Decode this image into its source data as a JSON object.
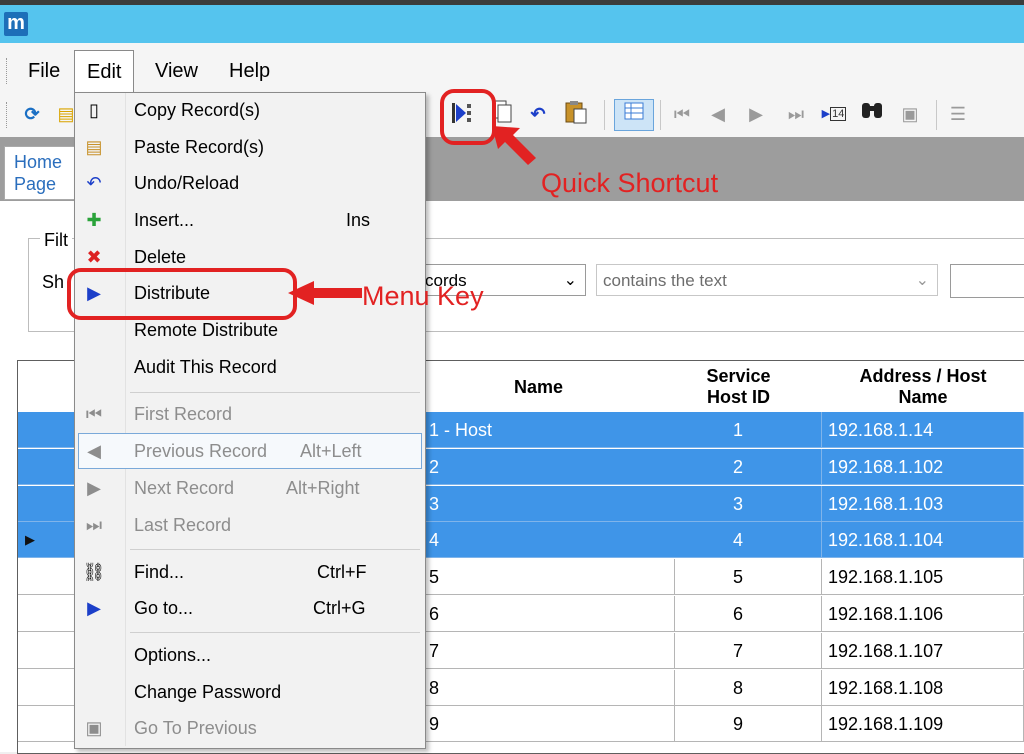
{
  "app": {
    "logo_letter": "m"
  },
  "menubar": {
    "items": [
      "File",
      "Edit",
      "View",
      "Help"
    ]
  },
  "toolbar": {
    "icons": [
      "refresh-icon",
      "folder-icon",
      "distribute-icon",
      "copy-icon",
      "undo-icon",
      "paste-icon",
      "grid-view-icon",
      "first-record-icon",
      "previous-record-icon",
      "next-record-icon",
      "last-record-icon",
      "go-to-icon",
      "find-icon",
      "go-to-previous-icon",
      "list-view-icon"
    ]
  },
  "tabs": {
    "home_line1": "Home",
    "home_line2": "Page"
  },
  "filter": {
    "legend": "Filt",
    "show_label": "Sh",
    "records_select": "cords",
    "match_select": "contains the text"
  },
  "grid": {
    "headers": {
      "name": "Name",
      "service_host_id_l1": "Service",
      "service_host_id_l2": "Host ID",
      "address_l1": "Address / Host",
      "address_l2": "Name"
    },
    "rows": [
      {
        "name": "1 - Host",
        "id": "1",
        "address": "192.168.1.14",
        "selected": true
      },
      {
        "name": "2",
        "id": "2",
        "address": "192.168.1.102",
        "selected": true
      },
      {
        "name": "3",
        "id": "3",
        "address": "192.168.1.103",
        "selected": true
      },
      {
        "name": "4",
        "id": "4",
        "address": "192.168.1.104",
        "selected": true,
        "current": true
      },
      {
        "name": "5",
        "id": "5",
        "address": "192.168.1.105",
        "selected": false
      },
      {
        "name": "6",
        "id": "6",
        "address": "192.168.1.106",
        "selected": false
      },
      {
        "name": "7",
        "id": "7",
        "address": "192.168.1.107",
        "selected": false
      },
      {
        "name": "8",
        "id": "8",
        "address": "192.168.1.108",
        "selected": false
      },
      {
        "name": "9",
        "id": "9",
        "address": "192.168.1.109",
        "selected": false
      }
    ]
  },
  "edit_menu": {
    "items": [
      {
        "label": "Copy Record(s)",
        "shortcut": "",
        "icon": "copy-icon"
      },
      {
        "label": "Paste Record(s)",
        "shortcut": "",
        "icon": "paste-icon"
      },
      {
        "label": "Undo/Reload",
        "shortcut": "",
        "icon": "undo-icon"
      },
      {
        "label": "Insert...",
        "shortcut": "Ins",
        "icon": "insert-icon"
      },
      {
        "label": "Delete",
        "shortcut": "",
        "icon": "delete-icon"
      },
      {
        "label": "Distribute",
        "shortcut": "",
        "icon": "distribute-icon"
      },
      {
        "label": "Remote Distribute",
        "shortcut": "",
        "icon": ""
      },
      {
        "label": "Audit This Record",
        "shortcut": "",
        "icon": ""
      },
      {
        "label": "First Record",
        "shortcut": "",
        "icon": "first-record-icon",
        "disabled": true
      },
      {
        "label": "Previous Record",
        "shortcut": "Alt+Left",
        "icon": "previous-record-icon",
        "disabled": true
      },
      {
        "label": "Next Record",
        "shortcut": "Alt+Right",
        "icon": "next-record-icon",
        "disabled": true
      },
      {
        "label": "Last Record",
        "shortcut": "",
        "icon": "last-record-icon",
        "disabled": true
      },
      {
        "label": "Find...",
        "shortcut": "Ctrl+F",
        "icon": "find-icon"
      },
      {
        "label": "Go to...",
        "shortcut": "Ctrl+G",
        "icon": "go-to-icon"
      },
      {
        "label": "Options...",
        "shortcut": "",
        "icon": ""
      },
      {
        "label": "Change Password",
        "shortcut": "",
        "icon": ""
      },
      {
        "label": "Go To Previous",
        "shortcut": "",
        "icon": "go-to-previous-icon",
        "disabled": true
      }
    ]
  },
  "annotations": {
    "menu_key": "Menu Key",
    "quick_shortcut": "Quick Shortcut"
  },
  "colors": {
    "accent": "#e22222",
    "selection": "#3f95e8",
    "titlebar": "#55c4ee"
  }
}
